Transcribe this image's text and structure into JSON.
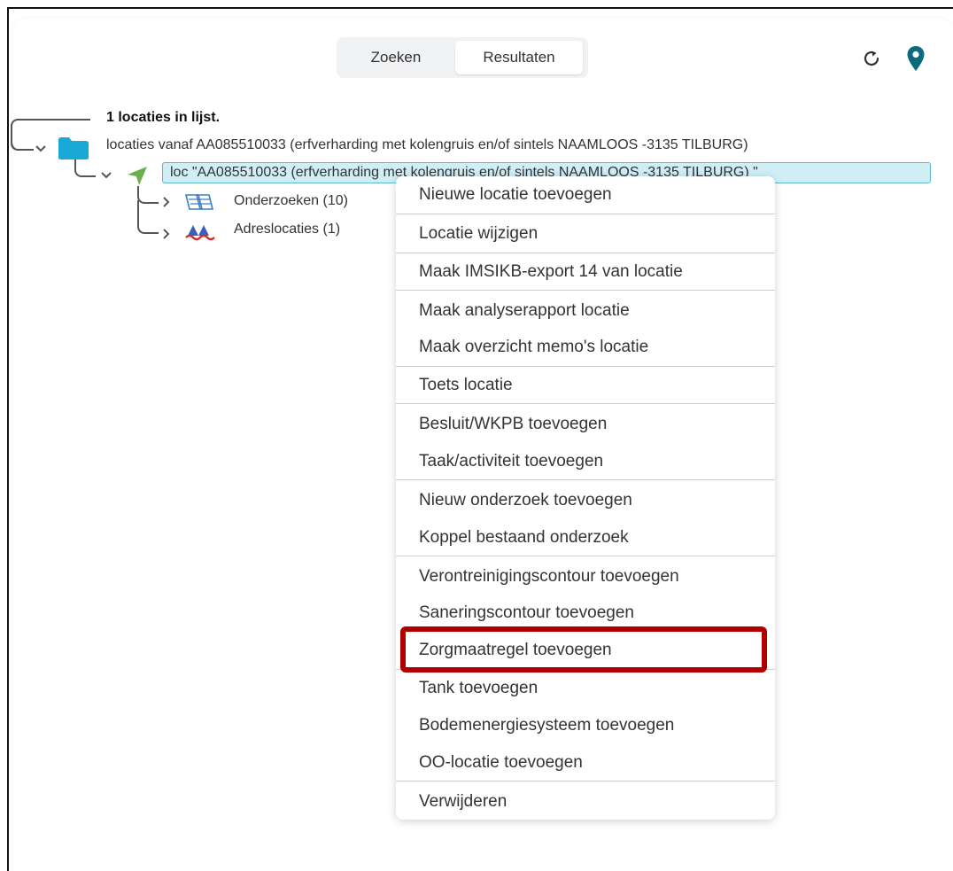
{
  "tabs": {
    "zoeken": "Zoeken",
    "resultaten": "Resultaten",
    "active": "resultaten"
  },
  "header_icons": [
    "refresh-icon",
    "map-pin-icon"
  ],
  "tree": {
    "summary": "1 locaties in lijst.",
    "root_label": "locaties vanaf AA085510033 (erfverharding met kolengruis en/of sintels NAAMLOOS -3135 TILBURG)",
    "location_label": "loc \"AA085510033 (erfverharding met kolengruis en/of sintels NAAMLOOS -3135 TILBURG) \"",
    "children": [
      {
        "label": "Onderzoeken (10)"
      },
      {
        "label": "Adreslocaties (1)"
      }
    ]
  },
  "menu": {
    "items": [
      "Nieuwe locatie toevoegen",
      "Locatie wijzigen",
      "Maak IMSIKB-export 14 van locatie",
      "Maak analyserapport locatie",
      "Maak overzicht memo's locatie",
      "Toets locatie",
      "Besluit/WKPB toevoegen",
      "Taak/activiteit toevoegen",
      "Nieuw onderzoek toevoegen",
      "Koppel bestaand onderzoek",
      "Verontreinigingscontour toevoegen",
      "Saneringscontour toevoegen",
      "Zorgmaatregel toevoegen",
      "Tank toevoegen",
      "Bodemenergiesysteem toevoegen",
      "OO-locatie toevoegen",
      "Verwijderen"
    ],
    "highlighted_item": "Zorgmaatregel toevoegen",
    "highlight_color": "#b00000"
  },
  "colors": {
    "accent": "#00a3d9",
    "pin": "#0a6b7d",
    "selection": "#cfeef5",
    "arrow": "#6ab04c"
  }
}
